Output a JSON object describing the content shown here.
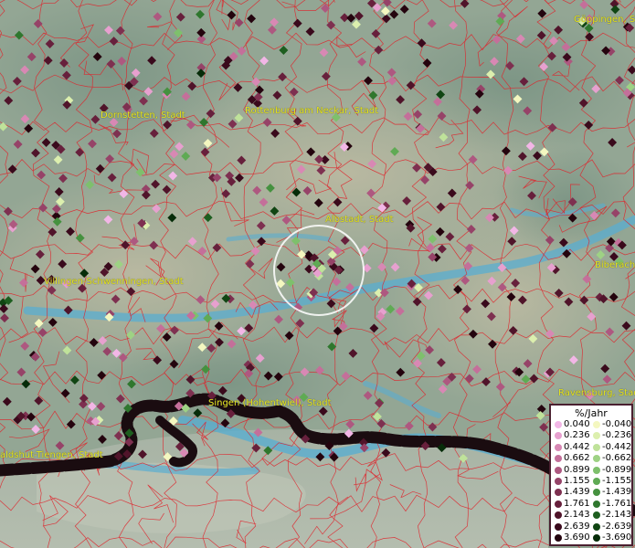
{
  "map": {
    "cities": [
      {
        "name": "Dornstetten, Stadt"
      },
      {
        "name": "Rottenburg am Neckar, Stadt"
      },
      {
        "name": "Albstadt, Stadt"
      },
      {
        "name": "Villingen-Schwenningen, Stadt"
      },
      {
        "name": "Singen (Hohentwiel), Stadt"
      },
      {
        "name": "aldshut-Tiengen, Stadt"
      },
      {
        "name": "Göppingen, Stadt"
      },
      {
        "name": "Biberach"
      },
      {
        "name": "Ravensburg, Stadt"
      }
    ]
  },
  "legend": {
    "title": "%/Jahr",
    "positive": [
      {
        "value": "0.040",
        "color": "#f2b6e6"
      },
      {
        "value": "0.236",
        "color": "#e7a0cf"
      },
      {
        "value": "0.442",
        "color": "#d888b4"
      },
      {
        "value": "0.662",
        "color": "#c46f9a"
      },
      {
        "value": "0.899",
        "color": "#ae5880"
      },
      {
        "value": "1.155",
        "color": "#964368"
      },
      {
        "value": "1.439",
        "color": "#7e3050"
      },
      {
        "value": "1.761",
        "color": "#67203c"
      },
      {
        "value": "2.143",
        "color": "#50142a"
      },
      {
        "value": "2.639",
        "color": "#3a0a1c"
      },
      {
        "value": "3.690",
        "color": "#24040e"
      }
    ],
    "negative": [
      {
        "value": "-0.040",
        "color": "#f4f7c0"
      },
      {
        "value": "-0.236",
        "color": "#dcefae"
      },
      {
        "value": "-0.442",
        "color": "#bfe29a"
      },
      {
        "value": "-0.662",
        "color": "#9ed284"
      },
      {
        "value": "-0.899",
        "color": "#7ec06c"
      },
      {
        "value": "-1.155",
        "color": "#5faa54"
      },
      {
        "value": "-1.439",
        "color": "#45913f"
      },
      {
        "value": "-1.761",
        "color": "#2f772e"
      },
      {
        "value": "-2.143",
        "color": "#1d5e1f"
      },
      {
        "value": "-2.639",
        "color": "#104513"
      },
      {
        "value": "-3.690",
        "color": "#062c09"
      }
    ]
  }
}
